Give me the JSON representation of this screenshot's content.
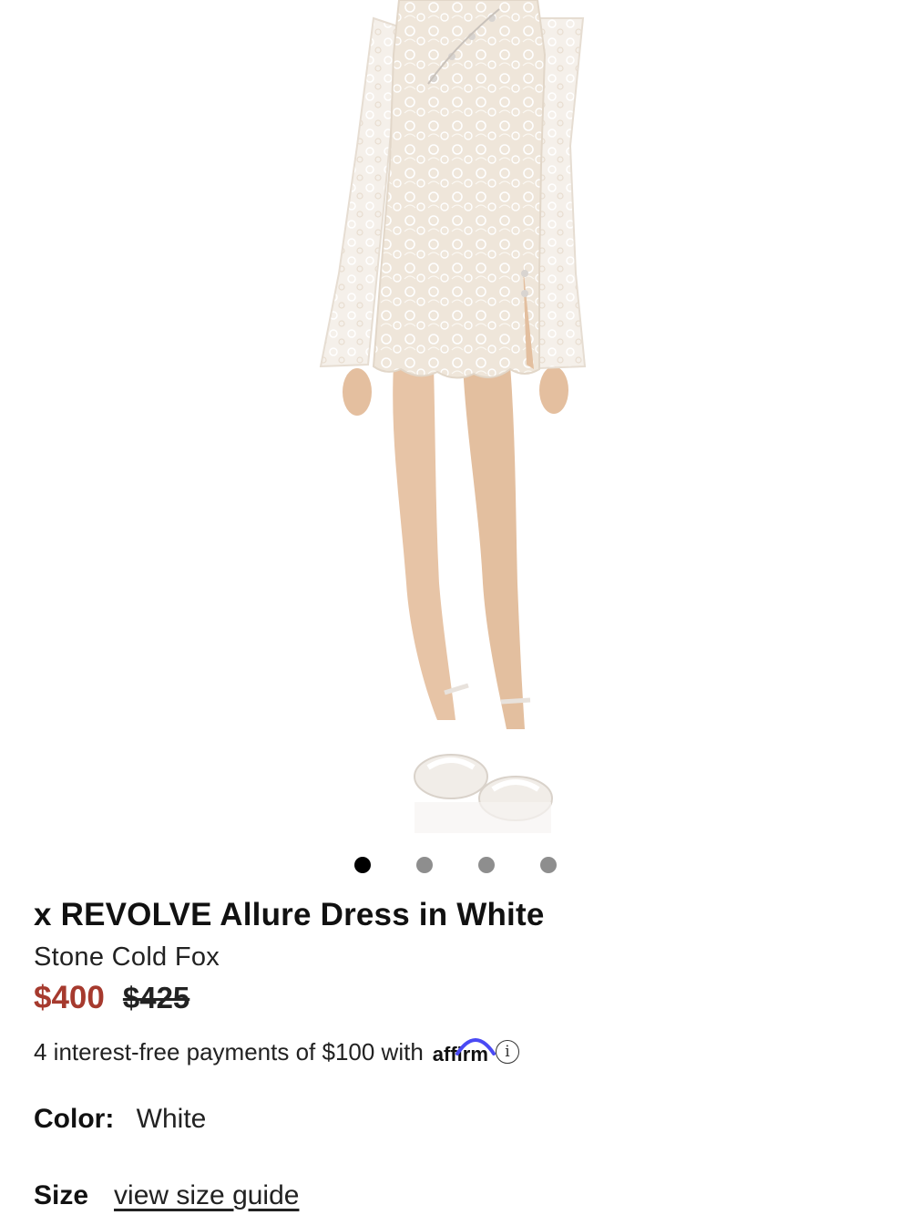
{
  "product": {
    "title": "x REVOLVE Allure Dress in White",
    "brand": "Stone Cold Fox",
    "price_sale": "$400",
    "price_original": "$425",
    "installments_text": "4 interest-free payments of $100 with",
    "affirm_logo_text": "affirm",
    "info_symbol": "i"
  },
  "gallery": {
    "image_count": 4,
    "active_index": 0
  },
  "options": {
    "color_label": "Color",
    "color_separator": ":",
    "color_value": "White",
    "size_label": "Size",
    "size_guide_link": "view size guide"
  },
  "colors": {
    "sale_price": "#a63a2e",
    "dot_active": "#000000",
    "dot_inactive": "#8e8e8e",
    "affirm_arc": "#4a4af4"
  }
}
